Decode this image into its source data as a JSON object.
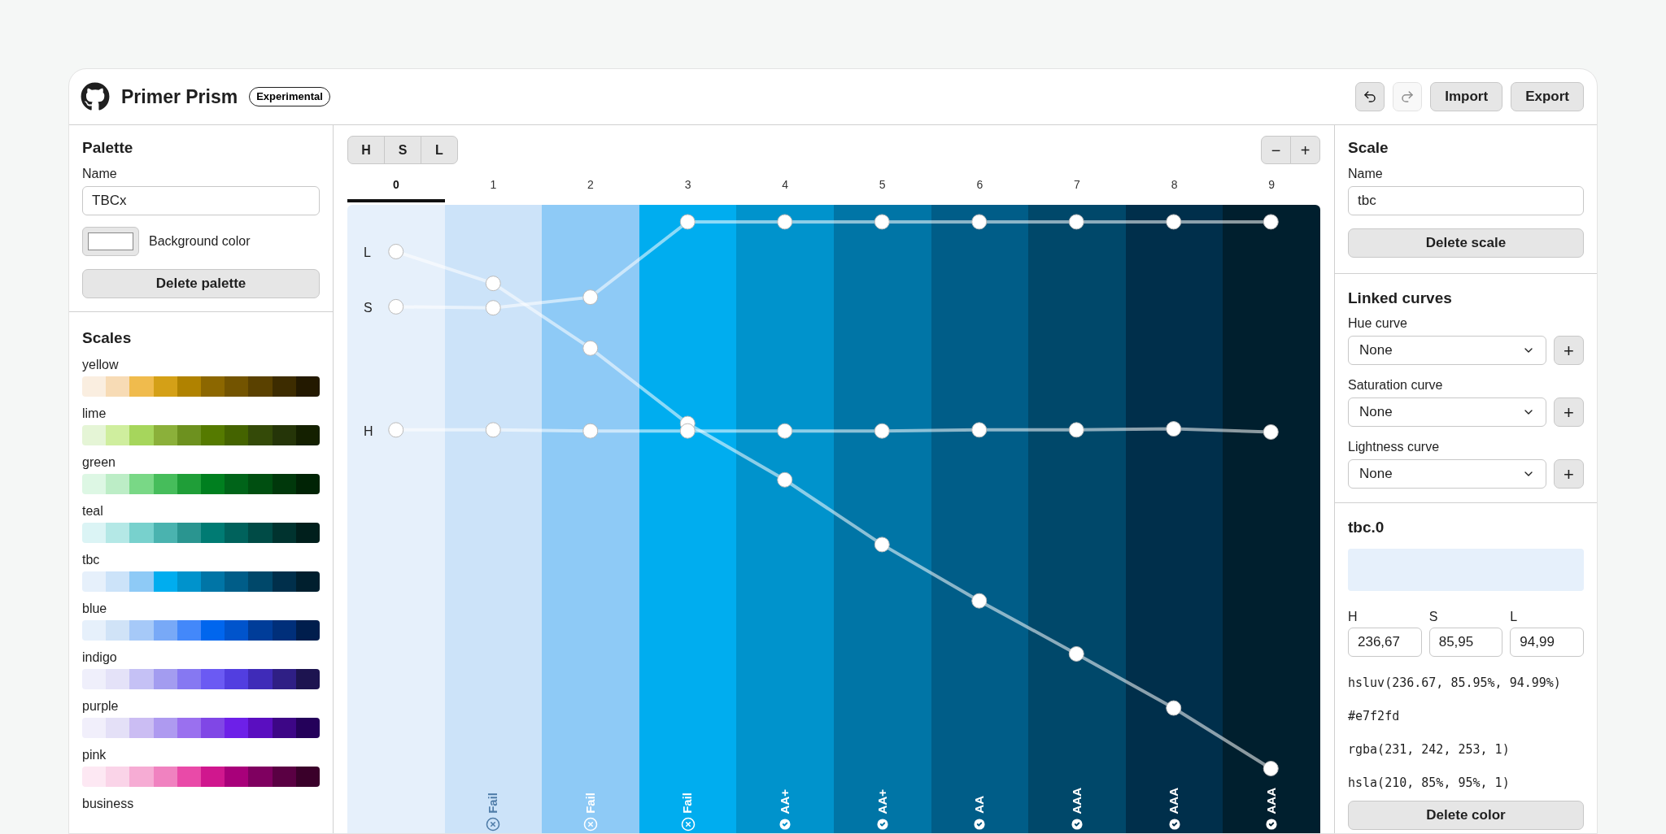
{
  "header": {
    "title": "Primer Prism",
    "badge": "Experimental",
    "buttons": [
      {
        "kind": "undo",
        "disabled": false
      },
      {
        "kind": "redo",
        "disabled": true
      },
      {
        "kind": "text",
        "label": "Import",
        "disabled": false
      },
      {
        "kind": "text",
        "label": "Export",
        "disabled": false
      }
    ]
  },
  "palette": {
    "title": "Palette",
    "name_label": "Name",
    "name_value": "TBCx",
    "background_label": "Background color",
    "delete_button": "Delete palette"
  },
  "scales": {
    "title": "Scales",
    "items": [
      {
        "name": "yellow",
        "swatches": [
          {
            "color": "#faeee0"
          },
          {
            "color": "#f7dbb5"
          },
          {
            "color": "#f0bb4d"
          },
          {
            "color": "#d4a017"
          },
          {
            "color": "#b08200"
          },
          {
            "color": "#8c6700"
          },
          {
            "color": "#735400"
          },
          {
            "color": "#5a4100"
          },
          {
            "color": "#3d2c00"
          },
          {
            "color": "#231900"
          }
        ]
      },
      {
        "name": "lime",
        "swatches": [
          {
            "color": "#e5f5d6"
          },
          {
            "color": "#cfee9e"
          },
          {
            "color": "#a6d65c"
          },
          {
            "color": "#8bb03a"
          },
          {
            "color": "#6d911f"
          },
          {
            "color": "#557a00"
          },
          {
            "color": "#446300"
          },
          {
            "color": "#344a08"
          },
          {
            "color": "#253508"
          },
          {
            "color": "#142000"
          }
        ]
      },
      {
        "name": "green",
        "swatches": [
          {
            "color": "#ddf7e4"
          },
          {
            "color": "#bcedc6"
          },
          {
            "color": "#79d886"
          },
          {
            "color": "#46bd5b"
          },
          {
            "color": "#1f9e38"
          },
          {
            "color": "#007f1f"
          },
          {
            "color": "#006419"
          },
          {
            "color": "#004f11"
          },
          {
            "color": "#00380b"
          },
          {
            "color": "#002305"
          }
        ]
      },
      {
        "name": "teal",
        "swatches": [
          {
            "color": "#dbf4f5"
          },
          {
            "color": "#b4e8e6"
          },
          {
            "color": "#78d1cd"
          },
          {
            "color": "#4ab3af"
          },
          {
            "color": "#2a9590"
          },
          {
            "color": "#007b73"
          },
          {
            "color": "#00625c"
          },
          {
            "color": "#004b46"
          },
          {
            "color": "#00332f"
          },
          {
            "color": "#001f1c"
          }
        ]
      },
      {
        "name": "tbc",
        "swatches": [
          {
            "color": "#e6f0fb"
          },
          {
            "color": "#cce3f9"
          },
          {
            "color": "#8ecaf6"
          },
          {
            "color": "#00adef"
          },
          {
            "color": "#0093cc"
          },
          {
            "color": "#0075a6"
          },
          {
            "color": "#005d88"
          },
          {
            "color": "#00486a"
          },
          {
            "color": "#002f4b"
          },
          {
            "color": "#001f2e"
          }
        ]
      },
      {
        "name": "blue",
        "swatches": [
          {
            "color": "#e6f0fb"
          },
          {
            "color": "#d0e3f7"
          },
          {
            "color": "#a6c9f8"
          },
          {
            "color": "#78a9f7"
          },
          {
            "color": "#4388fa"
          },
          {
            "color": "#0066ee"
          },
          {
            "color": "#0054cc"
          },
          {
            "color": "#003d99"
          },
          {
            "color": "#002f7a"
          },
          {
            "color": "#001e4d"
          }
        ]
      },
      {
        "name": "indigo",
        "swatches": [
          {
            "color": "#efeffb"
          },
          {
            "color": "#e4e2f8"
          },
          {
            "color": "#c5c1f5"
          },
          {
            "color": "#a39cf0"
          },
          {
            "color": "#8678f2"
          },
          {
            "color": "#6b5af3"
          },
          {
            "color": "#523ee0"
          },
          {
            "color": "#3f2bb8"
          },
          {
            "color": "#2f1f85"
          },
          {
            "color": "#1d1450"
          }
        ]
      },
      {
        "name": "purple",
        "swatches": [
          {
            "color": "#f1effb"
          },
          {
            "color": "#e4e0f7"
          },
          {
            "color": "#cbbdf3"
          },
          {
            "color": "#ae9af0"
          },
          {
            "color": "#9a70ef"
          },
          {
            "color": "#8047e6"
          },
          {
            "color": "#6d20e8"
          },
          {
            "color": "#5a0ec0"
          },
          {
            "color": "#3d0686"
          },
          {
            "color": "#24015a"
          }
        ]
      },
      {
        "name": "pink",
        "swatches": [
          {
            "color": "#fde8f3"
          },
          {
            "color": "#fad4e8"
          },
          {
            "color": "#f6acd4"
          },
          {
            "color": "#f082c0"
          },
          {
            "color": "#e94aa8"
          },
          {
            "color": "#d0178e"
          },
          {
            "color": "#a8007a"
          },
          {
            "color": "#7f0060"
          },
          {
            "color": "#5a0043"
          },
          {
            "color": "#3a002a"
          }
        ]
      },
      {
        "name": "business"
      }
    ]
  },
  "toolbar": {
    "channels": [
      "H",
      "S",
      "L"
    ],
    "zoom_out": "−",
    "zoom_in": "+"
  },
  "curves": [
    {
      "label": "L"
    },
    {
      "label": "S"
    },
    {
      "label": "H"
    }
  ],
  "columns": [
    {
      "label": "0",
      "selected": true,
      "color": "#e6f0fb"
    },
    {
      "label": "1",
      "selected": false,
      "color": "#cce3f9",
      "rating": "Fail",
      "pass": false
    },
    {
      "label": "2",
      "selected": false,
      "color": "#8ecaf6",
      "rating": "Fail",
      "pass": false
    },
    {
      "label": "3",
      "selected": false,
      "color": "#00adef",
      "rating": "Fail",
      "pass": false
    },
    {
      "label": "4",
      "selected": false,
      "color": "#0093cc",
      "rating": "AA+",
      "pass": true
    },
    {
      "label": "5",
      "selected": false,
      "color": "#0075a6",
      "rating": "AA+",
      "pass": true
    },
    {
      "label": "6",
      "selected": false,
      "color": "#005d88",
      "rating": "AA",
      "pass": true
    },
    {
      "label": "7",
      "selected": false,
      "color": "#00486a",
      "rating": "AAA",
      "pass": true
    },
    {
      "label": "8",
      "selected": false,
      "color": "#002f4b",
      "rating": "AAA",
      "pass": true
    },
    {
      "label": "9",
      "selected": false,
      "color": "#001f2e",
      "rating": "AAA",
      "pass": true
    }
  ],
  "scale": {
    "title": "Scale",
    "name_label": "Name",
    "name_value": "tbc",
    "delete_button": "Delete scale"
  },
  "linked_curves": {
    "title": "Linked curves",
    "items": [
      {
        "label": "Hue curve",
        "value": "None",
        "add": "+"
      },
      {
        "label": "Saturation curve",
        "value": "None",
        "add": "+"
      },
      {
        "label": "Lightness curve",
        "value": "None",
        "add": "+"
      }
    ]
  },
  "color": {
    "title": "tbc.0",
    "fields": [
      {
        "label": "H",
        "value": "236,67"
      },
      {
        "label": "S",
        "value": "85,95"
      },
      {
        "label": "L",
        "value": "94,99"
      }
    ],
    "formats": [
      "hsluv(236.67, 85.95%, 94.99%)",
      "#e7f2fd",
      "rgba(231, 242, 253, 1)",
      "hsla(210, 85%, 95%, 1)"
    ],
    "delete_button": "Delete color"
  }
}
